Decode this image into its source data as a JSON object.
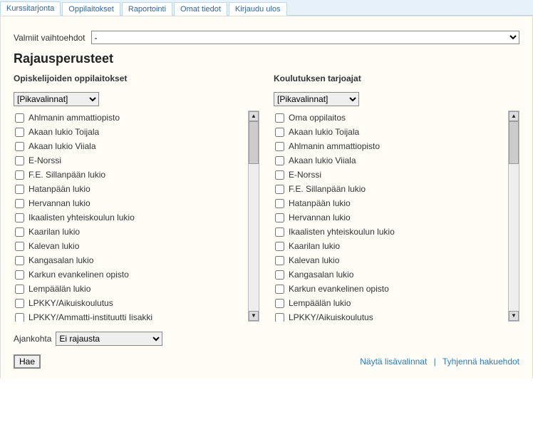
{
  "tabs": [
    "Kurssitarjonta",
    "Oppilaitokset",
    "Raportointi",
    "Omat tiedot",
    "Kirjaudu ulos"
  ],
  "active_tab": 0,
  "valmiit_label": "Valmiit vaihtoehdot",
  "valmiit_value": "-",
  "heading": "Rajausperusteet",
  "left": {
    "title": "Opiskelijoiden oppilaitokset",
    "pika": "[Pikavalinnat]",
    "items": [
      "Ahlmanin ammattiopisto",
      "Akaan lukio Toijala",
      "Akaan lukio Viiala",
      "E-Norssi",
      "F.E. Sillanpään lukio",
      "Hatanpään lukio",
      "Hervannan lukio",
      "Ikaalisten yhteiskoulun lukio",
      "Kaarilan lukio",
      "Kalevan lukio",
      "Kangasalan lukio",
      "Karkun evankelinen opisto",
      "Lempäälän lukio",
      "LPKKY/Aikuiskoulutus",
      "LPKKY/Ammatti-instituutti Iisakki"
    ]
  },
  "right": {
    "title": "Koulutuksen tarjoajat",
    "pika": "[Pikavalinnat]",
    "items": [
      "Oma oppilaitos",
      "Akaan lukio Toijala",
      "Ahlmanin ammattiopisto",
      "Akaan lukio Viiala",
      "E-Norssi",
      "F.E. Sillanpään lukio",
      "Hatanpään lukio",
      "Hervannan lukio",
      "Ikaalisten yhteiskoulun lukio",
      "Kaarilan lukio",
      "Kalevan lukio",
      "Kangasalan lukio",
      "Karkun evankelinen opisto",
      "Lempäälän lukio",
      "LPKKY/Aikuiskoulutus"
    ]
  },
  "ajankohta_label": "Ajankohta",
  "ajankohta_value": "Ei rajausta",
  "hae_label": "Hae",
  "link_lisavalinnat": "Näytä lisävalinnat",
  "link_tyhjenna": "Tyhjennä hakuehdot"
}
